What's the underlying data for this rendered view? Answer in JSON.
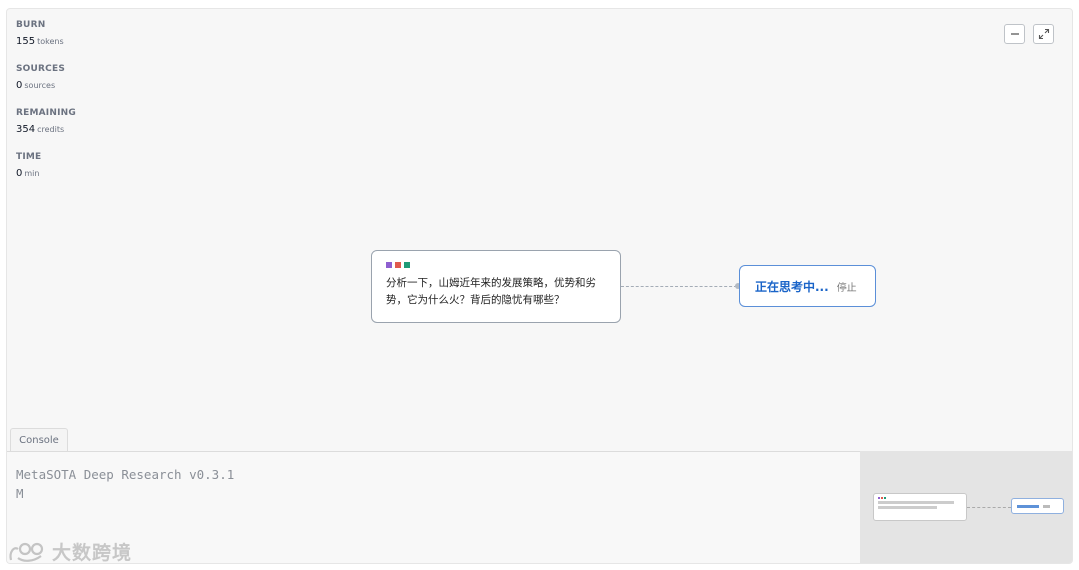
{
  "stats": {
    "burn": {
      "label": "BURN",
      "value": "155",
      "unit": "tokens"
    },
    "sources": {
      "label": "SOURCES",
      "value": "0",
      "unit": "sources"
    },
    "remaining": {
      "label": "REMAINING",
      "value": "354",
      "unit": "credits"
    },
    "time": {
      "label": "TIME",
      "value": "0",
      "unit": "min"
    }
  },
  "controls": {
    "minimize_icon": "minimize-icon",
    "expand_icon": "expand-icon"
  },
  "flow": {
    "query_dot_colors": [
      "#8e5fd0",
      "#e05a4e",
      "#1e9b77"
    ],
    "query_line1": "分析一下，山姆近年来的发展策略，优势和劣",
    "query_line2": "势，它为什么火？背后的隐忧有哪些？",
    "status_text": "正在思考中...",
    "stop_label": "停止"
  },
  "console": {
    "tab_label": "Console",
    "line1": "MetaSOTA Deep Research v0.3.1",
    "line2": "M"
  },
  "watermark": {
    "text": "大数跨境"
  }
}
